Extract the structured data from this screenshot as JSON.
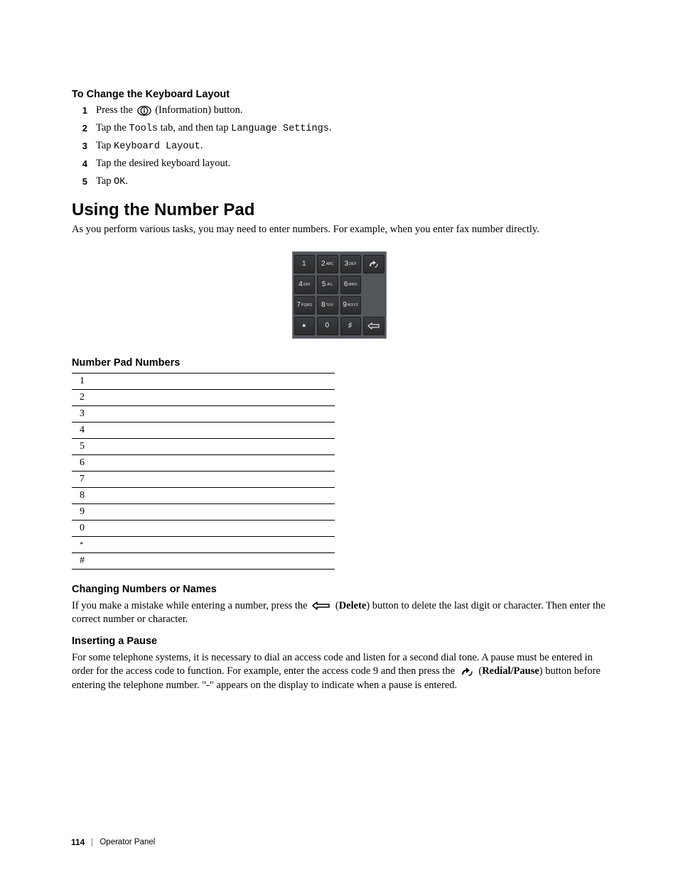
{
  "section1": {
    "heading": "To Change the Keyboard Layout",
    "steps": {
      "n1": "1",
      "n2": "2",
      "n3": "3",
      "n4": "4",
      "n5": "5",
      "s1a": "Press the ",
      "s1b": " (Information) button.",
      "s2a": "Tap the ",
      "s2b": "Tools",
      "s2c": " tab, and then tap ",
      "s2d": "Language Settings",
      "s2e": ".",
      "s3a": "Tap ",
      "s3b": "Keyboard Layout",
      "s3c": ".",
      "s4": "Tap the desired keyboard layout.",
      "s5a": "Tap ",
      "s5b": "OK",
      "s5c": "."
    }
  },
  "section2": {
    "heading": "Using the Number Pad",
    "intro": "As you perform various tasks, you may need to enter numbers. For example, when you enter fax number directly."
  },
  "keypad": {
    "k1": "1",
    "k2a": "2",
    "k2b": "ABC",
    "k3a": "3",
    "k3b": "DEF",
    "k4a": "4",
    "k4b": "GHI",
    "k5a": "5",
    "k5b": "JKL",
    "k6a": "6",
    "k6b": "MNO",
    "k7a": "7",
    "k7b": "PQRS",
    "k8a": "8",
    "k8b": "TUV",
    "k9a": "9",
    "k9b": "WXYZ",
    "kstar": "★",
    "k0": "0",
    "khash": "♯"
  },
  "section3": {
    "heading": "Number Pad Numbers",
    "rows": {
      "r1": "1",
      "r2": "2",
      "r3": "3",
      "r4": "4",
      "r5": "5",
      "r6": "6",
      "r7": "7",
      "r8": "8",
      "r9": "9",
      "r10": "0",
      "r11": "*",
      "r12": "#"
    }
  },
  "section4": {
    "heading": "Changing Numbers or Names",
    "p1a": "If you make a mistake while entering a number, press the ",
    "p1b": " (",
    "p1c": "Delete",
    "p1d": ") button to delete the last digit or character. Then enter the correct number or character."
  },
  "section5": {
    "heading": "Inserting a Pause",
    "p1a": "For some telephone systems, it is necessary to dial an access code and listen for a second dial tone. A pause must be entered in order for the access code to function. For example, enter the access code 9 and then press the ",
    "p1b": " (",
    "p1c": "Redial/Pause",
    "p1d": ") button before entering the telephone number. \"-\" appears on the display to indicate when a pause is entered."
  },
  "footer": {
    "page": "114",
    "chapter": "Operator Panel"
  }
}
